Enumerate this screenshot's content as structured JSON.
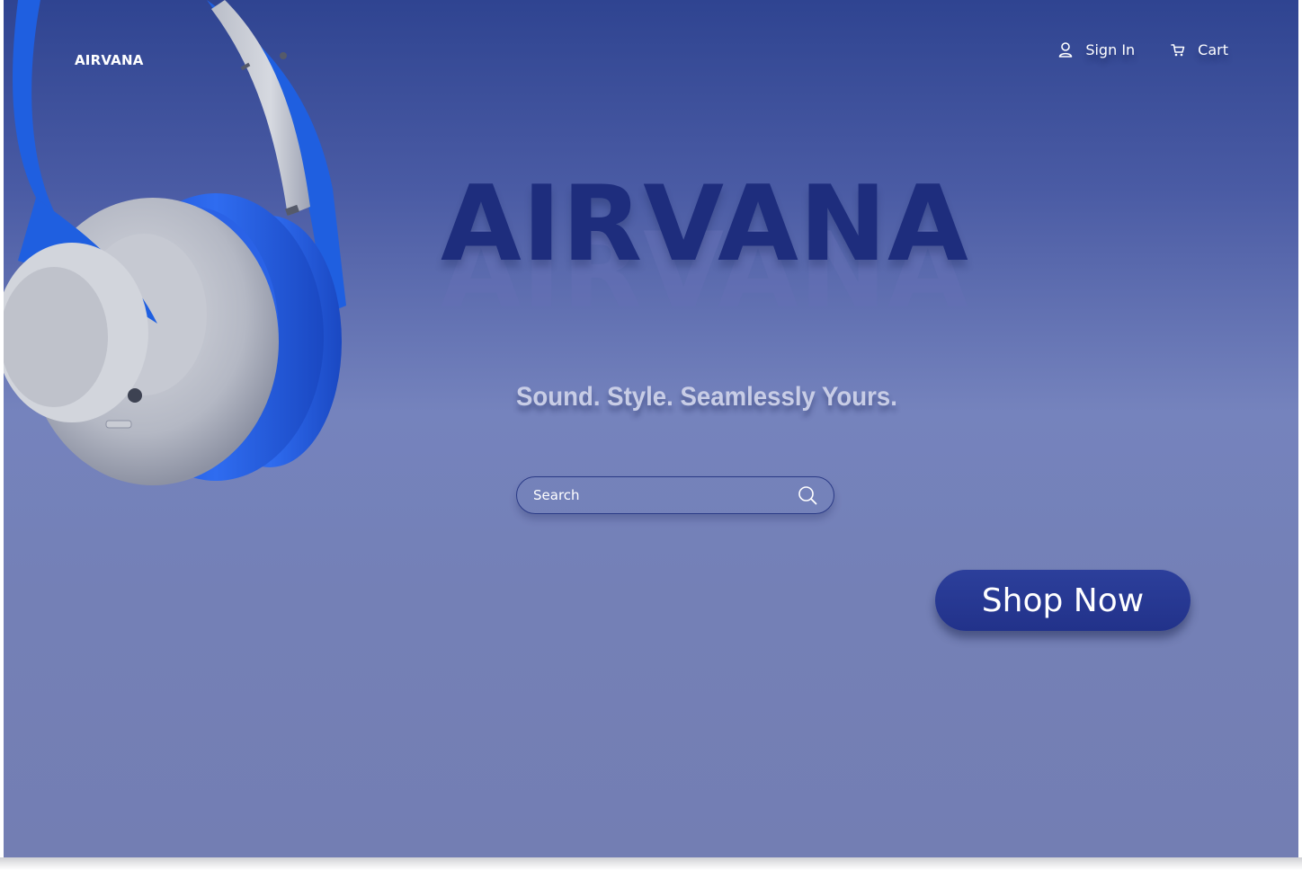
{
  "brand": {
    "logo_text": "AIRVANA"
  },
  "nav": {
    "sign_in_label": "Sign In",
    "sign_in_icon": "user-icon",
    "cart_label": "Cart",
    "cart_icon": "cart-icon"
  },
  "hero": {
    "title": "AIRVANA",
    "tagline": "Sound. Style. Seamlessly Yours."
  },
  "search": {
    "placeholder": "Search",
    "icon": "search-icon"
  },
  "cta": {
    "label": "Shop Now"
  },
  "colors": {
    "background_top": "#2f4491",
    "background_bottom": "#737eb3",
    "title_color": "#1e2d7d",
    "button_color": "#22328a",
    "headphone_accent": "#1f5fe0"
  }
}
